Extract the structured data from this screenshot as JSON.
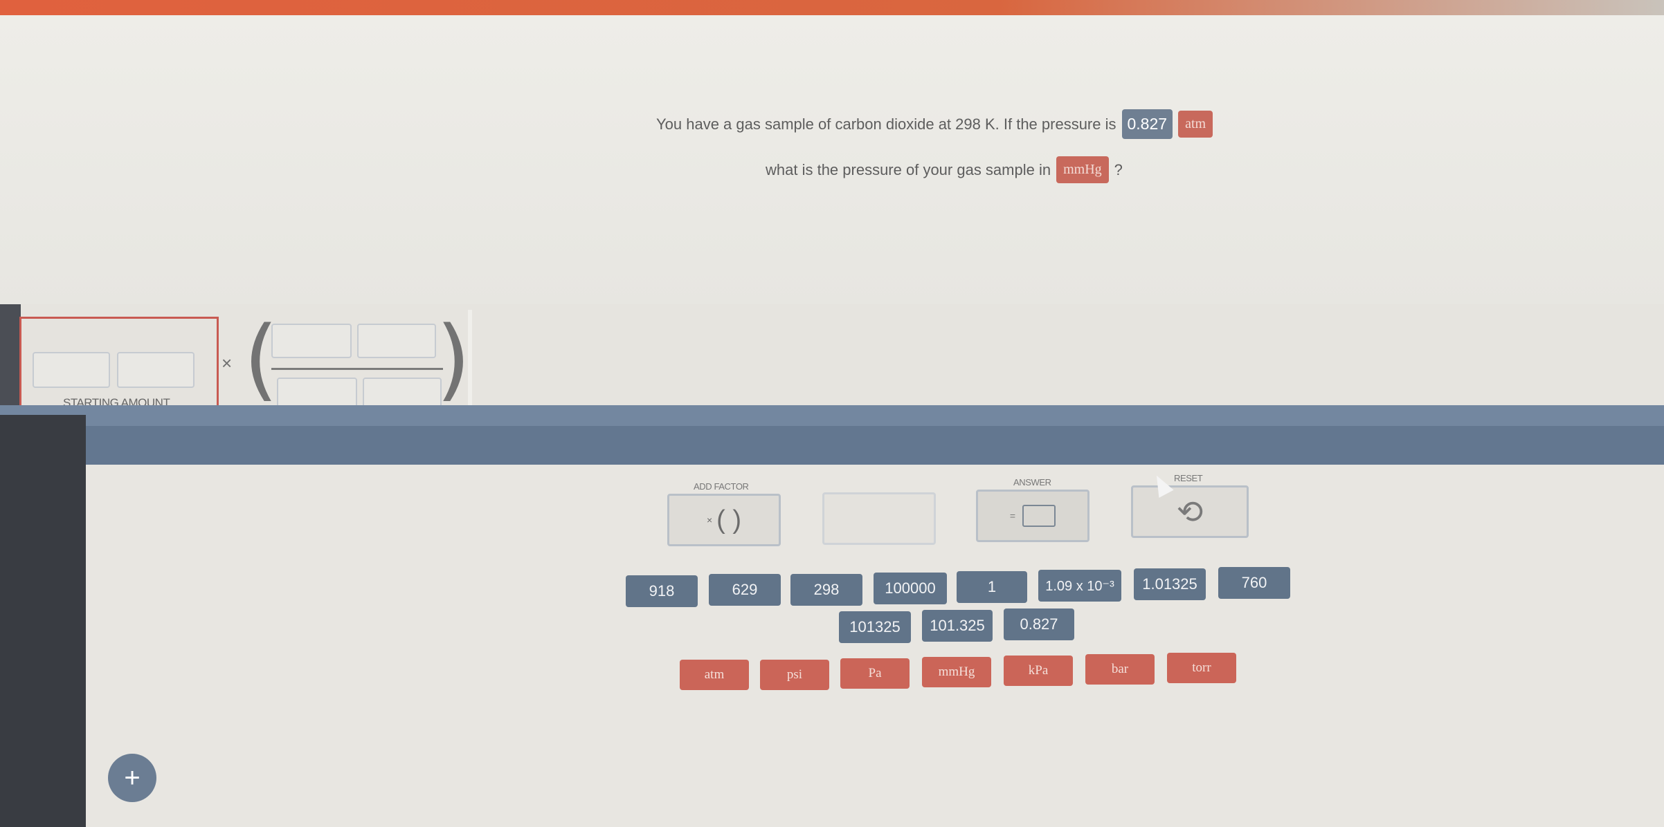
{
  "question": {
    "line1_text": "You have a gas sample of carbon dioxide at 298 K. If the pressure is",
    "given_value": "0.827",
    "given_unit": "atm",
    "line2_text": "what is the pressure of your gas sample in",
    "target_unit": "mmHg",
    "line2_end": "?"
  },
  "setup": {
    "starting_amount_label": "STARTING AMOUNT",
    "times_symbol": "×",
    "open_paren": "(",
    "close_paren": ")"
  },
  "controls": {
    "add_factor_label": "ADD FACTOR",
    "add_factor_symbol": "×",
    "add_factor_parens": "( )",
    "answer_label": "ANSWER",
    "answer_eq": "=",
    "reset_label": "RESET",
    "reset_icon": "undo-icon"
  },
  "number_tiles_row1": [
    "918",
    "629",
    "298",
    "100000",
    "1",
    "1.09 x 10⁻³",
    "1.01325",
    "760"
  ],
  "number_tiles_row2": [
    "101325",
    "101.325",
    "0.827"
  ],
  "unit_tiles": [
    "atm",
    "psi",
    "Pa",
    "mmHg",
    "kPa",
    "bar",
    "torr"
  ],
  "fab_label": "+",
  "colors": {
    "value_tile": "#617489",
    "unit_tile": "#cb6558",
    "accent_border": "#c85a52"
  }
}
